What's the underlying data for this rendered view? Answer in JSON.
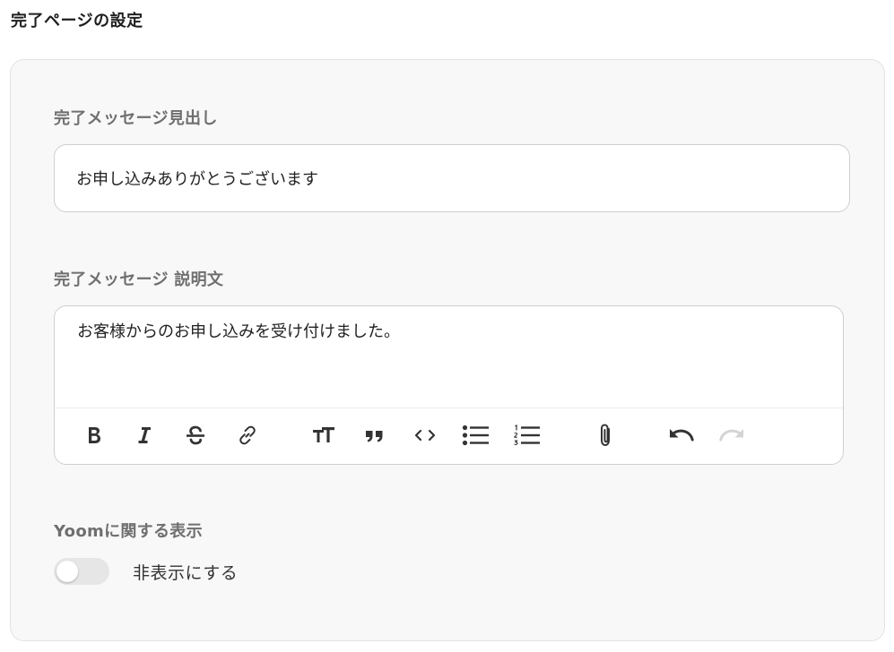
{
  "page": {
    "title": "完了ページの設定"
  },
  "completion_heading": {
    "label": "完了メッセージ見出し",
    "value": "お申し込みありがとうございます"
  },
  "completion_description": {
    "label": "完了メッセージ 説明文",
    "value": "お客様からのお申し込みを受け付けました。"
  },
  "toolbar": {
    "icons": [
      "bold-icon",
      "italic-icon",
      "strikethrough-icon",
      "link-icon",
      "heading-icon",
      "quote-icon",
      "code-icon",
      "bullet-list-icon",
      "numbered-list-icon",
      "attachment-icon",
      "undo-icon",
      "redo-icon"
    ],
    "icon_color": "#333333",
    "disabled_icon_color": "#d4d4d4"
  },
  "yoom_display": {
    "label": "Yoomに関する表示",
    "toggle_on": false,
    "toggle_label": "非表示にする"
  },
  "colors": {
    "card_background": "#f8f8f8",
    "label_text": "#6f6f6f",
    "toggle_track_off": "#e6e6e6"
  }
}
